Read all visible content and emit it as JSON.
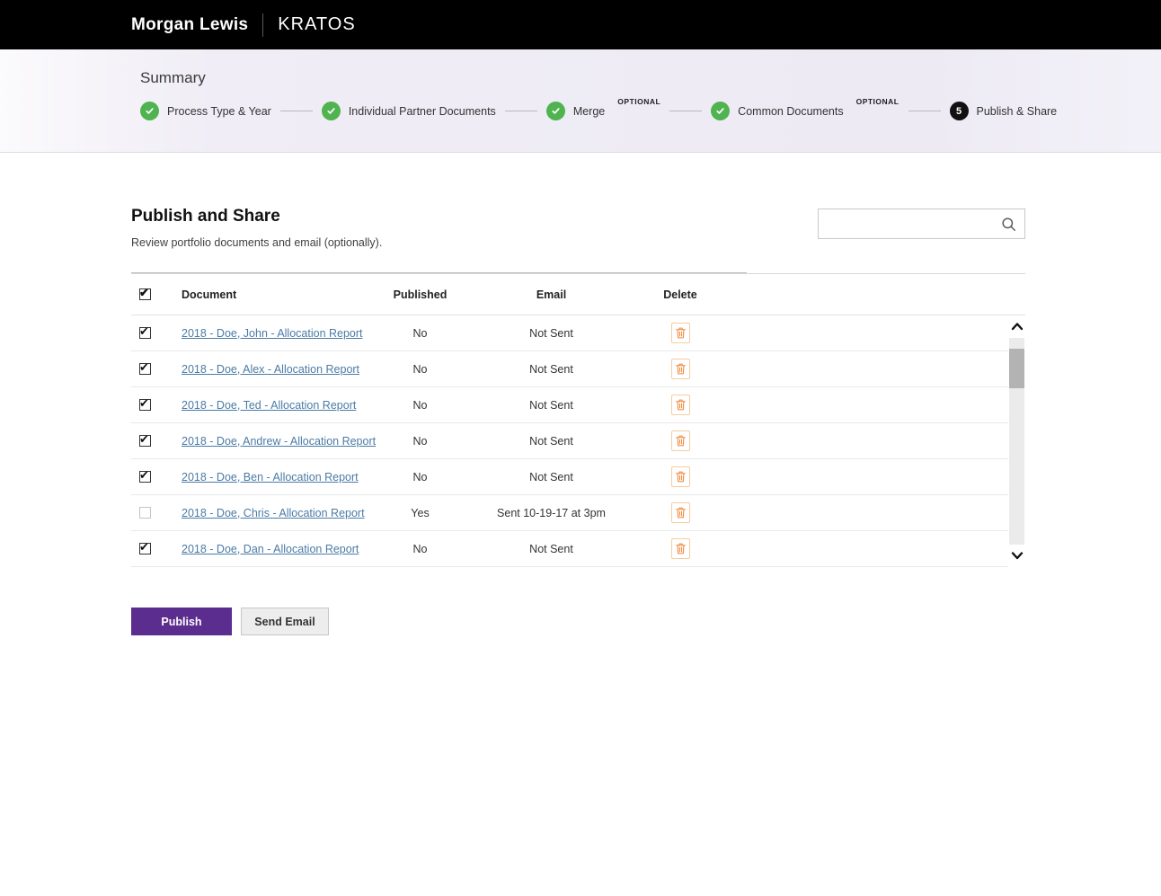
{
  "topbar": {
    "brand": "Morgan Lewis",
    "app": "KRATOS"
  },
  "stepper": {
    "title": "Summary",
    "steps": [
      {
        "label": "Process Type & Year",
        "state": "complete"
      },
      {
        "label": "Individual Partner Documents",
        "state": "complete"
      },
      {
        "label": "Merge",
        "state": "complete",
        "optional": "OPTIONAL"
      },
      {
        "label": "Common Documents",
        "state": "complete",
        "optional": "OPTIONAL"
      },
      {
        "label": "Publish & Share",
        "state": "current",
        "number": "5"
      }
    ]
  },
  "main": {
    "title": "Publish and Share",
    "subtitle": "Review portfolio documents and email (optionally).",
    "search": {
      "value": "",
      "placeholder": ""
    },
    "table": {
      "headers": {
        "document": "Document",
        "published": "Published",
        "email": "Email",
        "delete": "Delete"
      },
      "select_all_checked": true,
      "rows": [
        {
          "checked": true,
          "document": "2018 - Doe, John - Allocation Report",
          "published": "No",
          "email": "Not Sent"
        },
        {
          "checked": true,
          "document": "2018 - Doe, Alex - Allocation Report",
          "published": "No",
          "email": "Not Sent"
        },
        {
          "checked": true,
          "document": "2018 - Doe, Ted - Allocation Report",
          "published": "No",
          "email": "Not Sent"
        },
        {
          "checked": true,
          "document": "2018 - Doe, Andrew - Allocation Report",
          "published": "No",
          "email": "Not Sent"
        },
        {
          "checked": true,
          "document": "2018 - Doe, Ben - Allocation Report",
          "published": "No",
          "email": "Not Sent"
        },
        {
          "checked": false,
          "document": "2018 - Doe, Chris - Allocation Report",
          "published": "Yes",
          "email": "Sent 10-19-17 at 3pm"
        },
        {
          "checked": true,
          "document": "2018 - Doe, Dan - Allocation Report",
          "published": "No",
          "email": "Not Sent"
        }
      ]
    },
    "buttons": {
      "publish": "Publish",
      "send_email": "Send Email"
    },
    "icons": {
      "search": "search-icon",
      "trash": "trash-icon",
      "check": "check-icon",
      "scroll_up": "chevron-up-icon",
      "scroll_down": "chevron-down-icon"
    },
    "colors": {
      "accent_purple": "#5b2d8e",
      "step_green": "#4fb34f",
      "link_blue": "#4a7ba6",
      "trash_orange": "#ee8a3e",
      "topbar_black": "#000000"
    }
  }
}
